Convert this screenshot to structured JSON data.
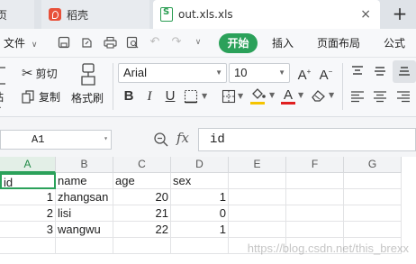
{
  "tabs": [
    {
      "label": "首页",
      "display": "首页"
    },
    {
      "label": "稻壳"
    },
    {
      "label": "out.xls.xls"
    }
  ],
  "tab_close": "×",
  "new_tab": "+",
  "menu": {
    "file": "文件",
    "start": "开始",
    "insert": "插入",
    "page_layout": "页面布局",
    "formula": "公式"
  },
  "ribbon": {
    "cut": "剪切",
    "copy": "复制",
    "paste": "粘贴",
    "format_painter": "格式刷",
    "font_name": "Arial",
    "font_size": "10"
  },
  "formula_bar": {
    "cell_ref": "A1",
    "fx": "fx",
    "content": "id"
  },
  "columns": [
    "A",
    "B",
    "C",
    "D",
    "E",
    "F",
    "G"
  ],
  "rows": [
    [
      "id",
      "name",
      "age",
      "sex"
    ],
    [
      "1",
      "zhangsan",
      "20",
      "1"
    ],
    [
      "2",
      "lisi",
      "21",
      "0"
    ],
    [
      "3",
      "wangwu",
      "22",
      "1"
    ]
  ],
  "watermark": "https://blog.csdn.net/this_brexx",
  "colors": {
    "accent": "#2ba15a",
    "tab_red": "#e8513a"
  }
}
